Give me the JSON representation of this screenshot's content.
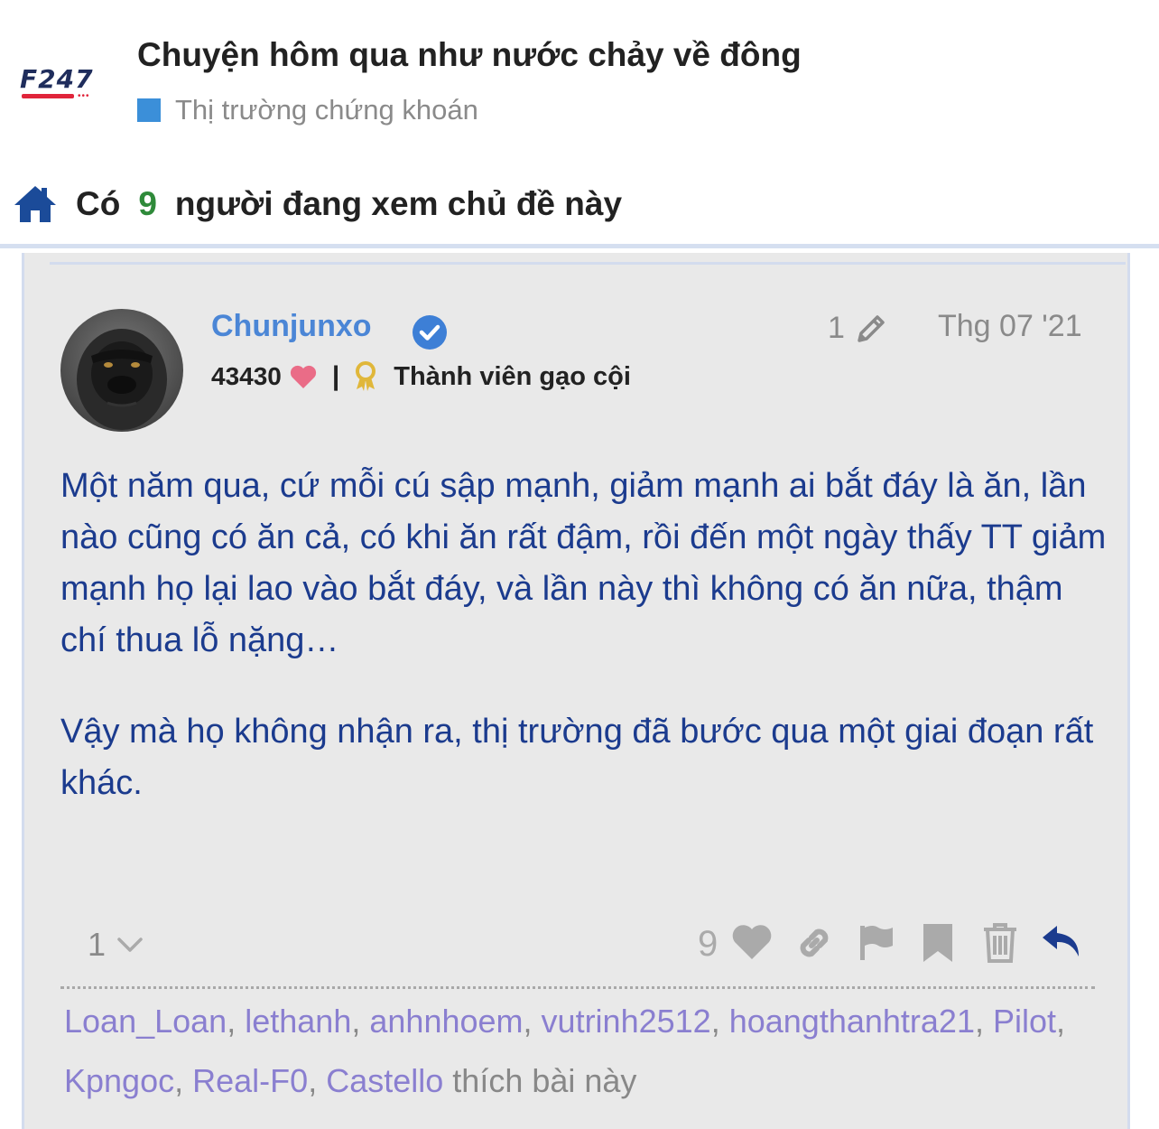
{
  "header": {
    "logo_text": "F247",
    "topic_title": "Chuyện hôm qua như nước chảy về đông",
    "category": {
      "label": "Thị trường chứng khoán",
      "color": "#3b8fd9"
    }
  },
  "viewers": {
    "prefix": "Có",
    "count": "9",
    "suffix": "người đang xem chủ đề này",
    "icon": "home-icon"
  },
  "post": {
    "username": "Chunjunxo",
    "verified_icon": "verified-check-icon",
    "likes_received": "43430",
    "separator": "|",
    "rank": "Thành viên gạo cội",
    "edit_count": "1",
    "date": "Thg 07 '21",
    "paragraphs": [
      "Một năm qua, cứ mỗi cú sập mạnh, giảm mạnh ai bắt đáy là ăn, lần nào cũng có ăn cả, có khi ăn rất đậm, rồi đến một ngày thấy TT giảm mạnh họ lại lao vào bắt đáy, và lần này thì không có ăn nữa, thậm chí thua lỗ nặng…",
      "Vậy mà họ không nhận ra, thị trường đã bước qua một giai đoạn rất khác."
    ],
    "reply_count": "1",
    "like_count": "9",
    "actions": [
      "heart-icon",
      "link-icon",
      "flag-icon",
      "bookmark-icon",
      "trash-icon",
      "reply-icon"
    ],
    "likers": {
      "names": [
        "Loan_Loan",
        "lethanh",
        "anhnhoem",
        "vutrinh2512",
        "hoangthanhtra21",
        "Pilot",
        "Kpngoc",
        "Real-F0",
        "Castello"
      ],
      "comma": ",",
      "suffix": "thích bài này"
    }
  },
  "colors": {
    "username": "#4b86d6",
    "body_text": "#1b3b8e",
    "viewer_count": "#2f8a3a",
    "liker_link": "#8a7fd0",
    "post_background": "#e9e9e9"
  }
}
